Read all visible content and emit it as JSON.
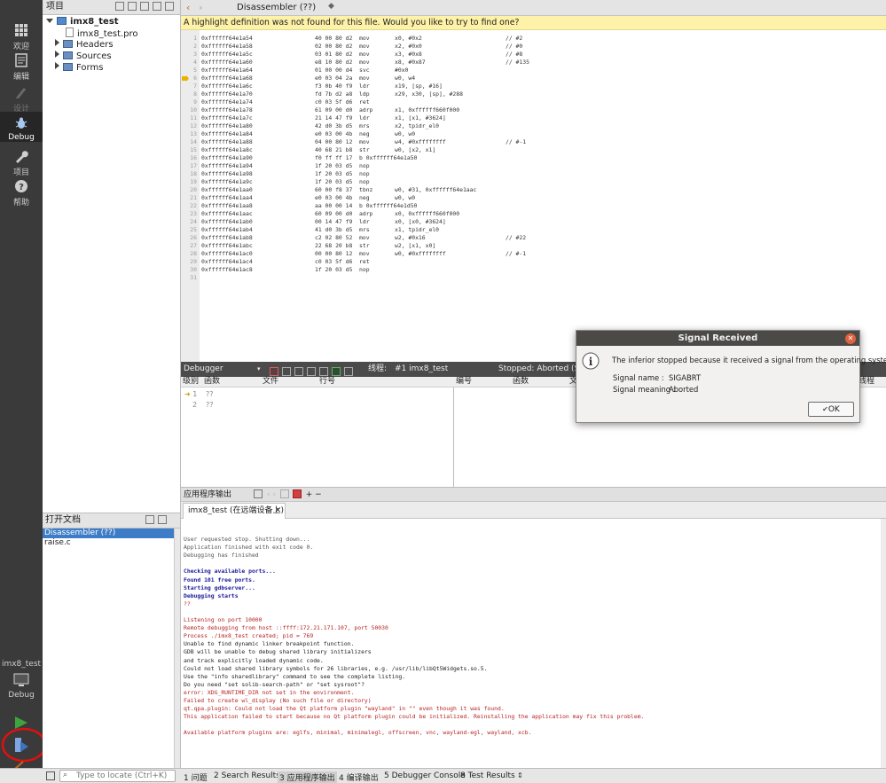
{
  "modes": [
    {
      "label": "欢迎",
      "icon": "grid-icon"
    },
    {
      "label": "编辑",
      "icon": "document-icon"
    },
    {
      "label": "设计",
      "icon": "pencil-icon"
    },
    {
      "label": "Debug",
      "icon": "bug-icon"
    },
    {
      "label": "项目",
      "icon": "wrench-icon"
    },
    {
      "label": "帮助",
      "icon": "help-icon"
    }
  ],
  "target": {
    "project": "imx8_test",
    "mode": "Debug"
  },
  "projects": {
    "header": "项目",
    "root": "imx8_test",
    "items": [
      "imx8_test.pro",
      "Headers",
      "Sources",
      "Forms"
    ]
  },
  "open_docs": {
    "header": "打开文档",
    "items": [
      "Disassembler (??)",
      "raise.c"
    ]
  },
  "editor": {
    "tab_title": "Disassembler (??)",
    "info_bar": "A highlight definition was not found for this file. Would you like to try to find one?",
    "lines": [
      {
        "n": "1",
        "addr": "0xffffff64e1a54",
        "bytes": "40 00 80 d2",
        "op": "mov",
        "args": "x0, #0x2",
        "cmt": "// #2"
      },
      {
        "n": "2",
        "addr": "0xffffff64e1a58",
        "bytes": "02 00 80 d2",
        "op": "mov",
        "args": "x2, #0x0",
        "cmt": "// #0"
      },
      {
        "n": "3",
        "addr": "0xffffff64e1a5c",
        "bytes": "03 01 80 d2",
        "op": "mov",
        "args": "x3, #0x8",
        "cmt": "// #8"
      },
      {
        "n": "4",
        "addr": "0xffffff64e1a60",
        "bytes": "e8 10 80 d2",
        "op": "mov",
        "args": "x8, #0x87",
        "cmt": "// #135"
      },
      {
        "n": "5",
        "addr": "0xffffff64e1a64",
        "bytes": "01 00 00 d4",
        "op": "svc",
        "args": "#0x0",
        "cmt": ""
      },
      {
        "n": "6",
        "addr": "0xffffff64e1a68",
        "bytes": "e0 03 04 2a",
        "op": "mov",
        "args": "w0, w4",
        "cmt": ""
      },
      {
        "n": "7",
        "addr": "0xffffff64e1a6c",
        "bytes": "f3 0b 40 f9",
        "op": "ldr",
        "args": "x19, [sp, #16]",
        "cmt": ""
      },
      {
        "n": "8",
        "addr": "0xffffff64e1a70",
        "bytes": "fd 7b d2 a8",
        "op": "ldp",
        "args": "x29, x30, [sp], #288",
        "cmt": ""
      },
      {
        "n": "9",
        "addr": "0xffffff64e1a74",
        "bytes": "c0 03 5f d6",
        "op": "ret",
        "args": "",
        "cmt": ""
      },
      {
        "n": "10",
        "addr": "0xffffff64e1a78",
        "bytes": "61 09 00 d0",
        "op": "adrp",
        "args": "x1, 0xffffff660f000",
        "cmt": ""
      },
      {
        "n": "11",
        "addr": "0xffffff64e1a7c",
        "bytes": "21 14 47 f9",
        "op": "ldr",
        "args": "x1, [x1, #3624]",
        "cmt": ""
      },
      {
        "n": "12",
        "addr": "0xffffff64e1a80",
        "bytes": "42 d0 3b d5",
        "op": "mrs",
        "args": "x2, tpidr_el0",
        "cmt": ""
      },
      {
        "n": "13",
        "addr": "0xffffff64e1a84",
        "bytes": "e0 03 00 4b",
        "op": "neg",
        "args": "w0, w0",
        "cmt": ""
      },
      {
        "n": "14",
        "addr": "0xffffff64e1a88",
        "bytes": "04 00 80 12",
        "op": "mov",
        "args": "w4, #0xffffffff",
        "cmt": "// #-1"
      },
      {
        "n": "15",
        "addr": "0xffffff64e1a8c",
        "bytes": "40 68 21 b8",
        "op": "str",
        "args": "w0, [x2, x1]",
        "cmt": ""
      },
      {
        "n": "16",
        "addr": "0xffffff64e1a90",
        "bytes": "f0 ff ff 17",
        "op": "b 0xffffff64e1a50",
        "args": "",
        "cmt": ""
      },
      {
        "n": "17",
        "addr": "0xffffff64e1a94",
        "bytes": "1f 20 03 d5",
        "op": "nop",
        "args": "",
        "cmt": ""
      },
      {
        "n": "18",
        "addr": "0xffffff64e1a98",
        "bytes": "1f 20 03 d5",
        "op": "nop",
        "args": "",
        "cmt": ""
      },
      {
        "n": "19",
        "addr": "0xffffff64e1a9c",
        "bytes": "1f 20 03 d5",
        "op": "nop",
        "args": "",
        "cmt": ""
      },
      {
        "n": "20",
        "addr": "0xffffff64e1aa0",
        "bytes": "60 00 f8 37",
        "op": "tbnz",
        "args": "w0, #31, 0xffffff64e1aac",
        "cmt": ""
      },
      {
        "n": "21",
        "addr": "0xffffff64e1aa4",
        "bytes": "e0 03 00 4b",
        "op": "neg",
        "args": "w0, w0",
        "cmt": ""
      },
      {
        "n": "22",
        "addr": "0xffffff64e1aa8",
        "bytes": "aa 00 00 14",
        "op": "b 0xffffff64e1d50",
        "args": "",
        "cmt": ""
      },
      {
        "n": "23",
        "addr": "0xffffff64e1aac",
        "bytes": "60 09 00 d0",
        "op": "adrp",
        "args": "x0, 0xffffff660f000",
        "cmt": ""
      },
      {
        "n": "24",
        "addr": "0xffffff64e1ab0",
        "bytes": "00 14 47 f9",
        "op": "ldr",
        "args": "x0, [x0, #3624]",
        "cmt": ""
      },
      {
        "n": "25",
        "addr": "0xffffff64e1ab4",
        "bytes": "41 d0 3b d5",
        "op": "mrs",
        "args": "x1, tpidr_el0",
        "cmt": ""
      },
      {
        "n": "26",
        "addr": "0xffffff64e1ab8",
        "bytes": "c2 02 80 52",
        "op": "mov",
        "args": "w2, #0x16",
        "cmt": "// #22"
      },
      {
        "n": "27",
        "addr": "0xffffff64e1abc",
        "bytes": "22 68 20 b8",
        "op": "str",
        "args": "w2, [x1, x0]",
        "cmt": ""
      },
      {
        "n": "28",
        "addr": "0xffffff64e1ac0",
        "bytes": "00 00 80 12",
        "op": "mov",
        "args": "w0, #0xffffffff",
        "cmt": "// #-1"
      },
      {
        "n": "29",
        "addr": "0xffffff64e1ac4",
        "bytes": "c0 03 5f d6",
        "op": "ret",
        "args": "",
        "cmt": ""
      },
      {
        "n": "30",
        "addr": "0xffffff64e1ac8",
        "bytes": "1f 20 03 d5",
        "op": "nop",
        "args": "",
        "cmt": ""
      },
      {
        "n": "31",
        "addr": "",
        "bytes": "",
        "op": "",
        "args": "",
        "cmt": ""
      }
    ]
  },
  "debugger": {
    "selector": "Debugger",
    "thread_label": "线程:",
    "thread_value": "#1 imx8_test",
    "status": "Stopped: Aborted (Signa",
    "stack_cols": [
      "级别",
      "函数",
      "文件",
      "行号"
    ],
    "stack_rows": [
      {
        "level": "1",
        "func": "??"
      },
      {
        "level": "2",
        "func": "??"
      }
    ],
    "right_cols": [
      "编号",
      "函数",
      "文",
      "线程"
    ]
  },
  "output": {
    "header": "应用程序输出",
    "tab": "imx8_test (在远端设备上)",
    "lines": [
      {
        "t": "User requested stop. Shutting down...",
        "c": "gray"
      },
      {
        "t": "Application finished with exit code 0.",
        "c": "gray"
      },
      {
        "t": "Debugging has finished",
        "c": "gray"
      },
      {
        "t": "",
        "c": "gray"
      },
      {
        "t": "Checking available ports...",
        "c": "blue"
      },
      {
        "t": "Found 101 free ports.",
        "c": "blue"
      },
      {
        "t": "Starting gdbserver...",
        "c": "blue"
      },
      {
        "t": "Debugging starts",
        "c": "blue"
      },
      {
        "t": "??",
        "c": "red"
      },
      {
        "t": "",
        "c": "gray"
      },
      {
        "t": "Listening on port 10000",
        "c": "red"
      },
      {
        "t": "Remote debugging from host ::ffff:172.21.171.107, port 50030",
        "c": "red"
      },
      {
        "t": "Process ./imx8_test created; pid = 769",
        "c": "red"
      },
      {
        "t": "Unable to find dynamic linker breakpoint function.",
        "c": "black"
      },
      {
        "t": "GDB will be unable to debug shared library initializers",
        "c": "black"
      },
      {
        "t": "and track explicitly loaded dynamic code.",
        "c": "black"
      },
      {
        "t": "Could not load shared library symbols for 26 libraries, e.g. /usr/lib/libQt5Widgets.so.5.",
        "c": "black"
      },
      {
        "t": "Use the \"info sharedlibrary\" command to see the complete listing.",
        "c": "black"
      },
      {
        "t": "Do you need \"set solib-search-path\" or \"set sysroot\"?",
        "c": "black"
      },
      {
        "t": "error: XDG_RUNTIME_DIR not set in the environment.",
        "c": "red"
      },
      {
        "t": "Failed to create wl_display (No such file or directory)",
        "c": "red"
      },
      {
        "t": "qt.qpa.plugin: Could not load the Qt platform plugin \"wayland\" in \"\" even though it was found.",
        "c": "red"
      },
      {
        "t": "This application failed to start because no Qt platform plugin could be initialized. Reinstalling the application may fix this problem.",
        "c": "red"
      },
      {
        "t": "",
        "c": "gray"
      },
      {
        "t": "Available platform plugins are: eglfs, minimal, minimalegl, offscreen, vnc, wayland-egl, wayland, xcb.",
        "c": "red"
      }
    ]
  },
  "dialog": {
    "title": "Signal Received",
    "message": "The inferior stopped because it received a signal from the operating system.",
    "name_label": "Signal name :",
    "name_value": "SIGABRT",
    "meaning_label": "Signal meaning :",
    "meaning_value": "Aborted",
    "ok": "OK"
  },
  "statusbar": {
    "locate_placeholder": "Type to locate (Ctrl+K)",
    "tabs": [
      {
        "num": "1",
        "label": "问题"
      },
      {
        "num": "2",
        "label": "Search Results"
      },
      {
        "num": "3",
        "label": "应用程序输出"
      },
      {
        "num": "4",
        "label": "编译输出"
      },
      {
        "num": "5",
        "label": "Debugger Console"
      },
      {
        "num": "8",
        "label": "Test Results"
      }
    ]
  },
  "colors": {
    "accent": "#3d7dc8",
    "error_text": "#b52424",
    "annotation": "#e01010"
  }
}
